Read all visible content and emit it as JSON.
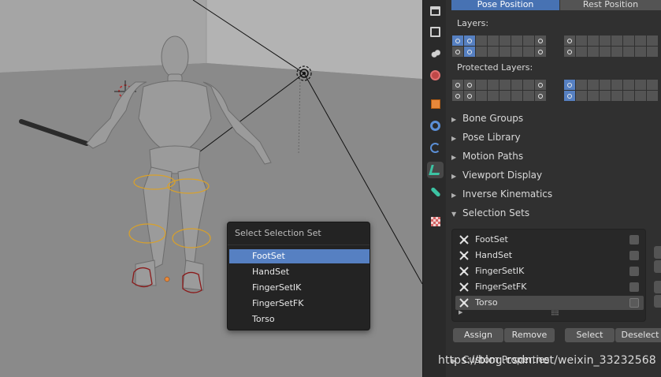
{
  "popup": {
    "title": "Select Selection Set",
    "items": [
      "FootSet",
      "HandSet",
      "FingerSetIK",
      "FingerSetFK",
      "Torso"
    ],
    "active_index": 0
  },
  "tabs": [
    {
      "name": "render-icon",
      "color": "#d0d0d0"
    },
    {
      "name": "output-icon",
      "color": "#d0d0d0"
    },
    {
      "name": "view-layer-icon",
      "color": "#d0d0d0"
    },
    {
      "name": "world-icon",
      "color": "#d46464"
    },
    {
      "name": "object-icon",
      "color": "#e8883a"
    },
    {
      "name": "modifier-icon",
      "color": "#5b8fd6"
    },
    {
      "name": "physics-icon",
      "color": "#5b8fd6"
    },
    {
      "name": "armature-data-icon",
      "color": "#3cc3a3"
    },
    {
      "name": "bone-icon",
      "color": "#3cc3a3"
    },
    {
      "name": "texture-icon",
      "color": "#d46464"
    }
  ],
  "panel": {
    "pose_position_label": "Pose Position",
    "rest_position_label": "Rest Position",
    "layers_label": "Layers:",
    "protected_layers_label": "Protected Layers:",
    "sections": [
      "Bone Groups",
      "Pose Library",
      "Motion Paths",
      "Viewport Display",
      "Inverse Kinematics",
      "Selection Sets"
    ],
    "selection_sets": [
      "FootSet",
      "HandSet",
      "FingerSetIK",
      "FingerSetFK",
      "Torso"
    ],
    "selected_set_index": 4,
    "buttons": {
      "assign": "Assign",
      "remove": "Remove",
      "select": "Select",
      "deselect": "Deselect"
    },
    "custom_properties_label": "Custom Properties"
  },
  "watermark": "https://blog.csdn.net/weixin_33232568",
  "colors": {
    "accent": "#4772b3",
    "highlight": "#5680c2",
    "bone_circle": "#d9a12a",
    "foot_red": "#8b1a1a"
  }
}
